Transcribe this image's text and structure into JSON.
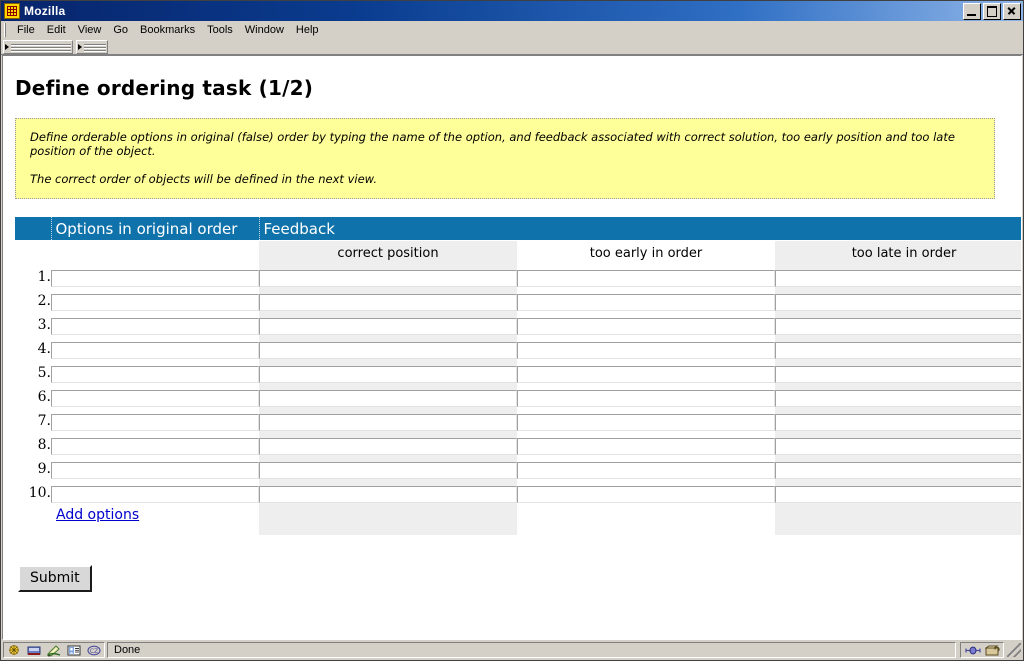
{
  "window": {
    "title": "Mozilla",
    "icon": "mozilla-icon",
    "buttons": {
      "minimize": "Minimize",
      "maximize": "Maximize",
      "close": "Close"
    }
  },
  "menu": {
    "items": [
      {
        "label": "File"
      },
      {
        "label": "Edit"
      },
      {
        "label": "View"
      },
      {
        "label": "Go"
      },
      {
        "label": "Bookmarks"
      },
      {
        "label": "Tools"
      },
      {
        "label": "Window"
      },
      {
        "label": "Help"
      }
    ]
  },
  "page": {
    "title": "Define ordering task (1/2)",
    "instructions": [
      "Define orderable options in original (false) order by typing the name of the option, and feedback associated with correct solution, too early position and too late position of the object.",
      "The correct order of objects will be defined in the next view."
    ]
  },
  "table": {
    "group_headers": {
      "number": "",
      "options": "Options in original order",
      "feedback": "Feedback"
    },
    "sub_headers": {
      "options": "",
      "correct_position": "correct position",
      "too_early": "too early in order",
      "too_late": "too late in order"
    },
    "rows": [
      {
        "number": "1.",
        "option": "",
        "correct_position": "",
        "too_early": "",
        "too_late": ""
      },
      {
        "number": "2.",
        "option": "",
        "correct_position": "",
        "too_early": "",
        "too_late": ""
      },
      {
        "number": "3.",
        "option": "",
        "correct_position": "",
        "too_early": "",
        "too_late": ""
      },
      {
        "number": "4.",
        "option": "",
        "correct_position": "",
        "too_early": "",
        "too_late": ""
      },
      {
        "number": "5.",
        "option": "",
        "correct_position": "",
        "too_early": "",
        "too_late": ""
      },
      {
        "number": "6.",
        "option": "",
        "correct_position": "",
        "too_early": "",
        "too_late": ""
      },
      {
        "number": "7.",
        "option": "",
        "correct_position": "",
        "too_early": "",
        "too_late": ""
      },
      {
        "number": "8.",
        "option": "",
        "correct_position": "",
        "too_early": "",
        "too_late": ""
      },
      {
        "number": "9.",
        "option": "",
        "correct_position": "",
        "too_early": "",
        "too_late": ""
      },
      {
        "number": "10.",
        "option": "",
        "correct_position": "",
        "too_early": "",
        "too_late": ""
      }
    ],
    "add_options_link": "Add options"
  },
  "form": {
    "submit_label": "Submit"
  },
  "statusbar": {
    "message": "Done",
    "left_icons": [
      "page-status-icon",
      "connection-icon",
      "pencil-icon",
      "contact-icon",
      "privacy-icon"
    ],
    "right_icons": [
      "network-transfer-icon",
      "security-lock-icon"
    ]
  },
  "colors": {
    "header_blue": "#0f72ab",
    "info_yellow": "#ffff99",
    "link_blue": "#0000cc",
    "column_shade": "#eeeeee",
    "titlebar_blue": "#08246b"
  }
}
